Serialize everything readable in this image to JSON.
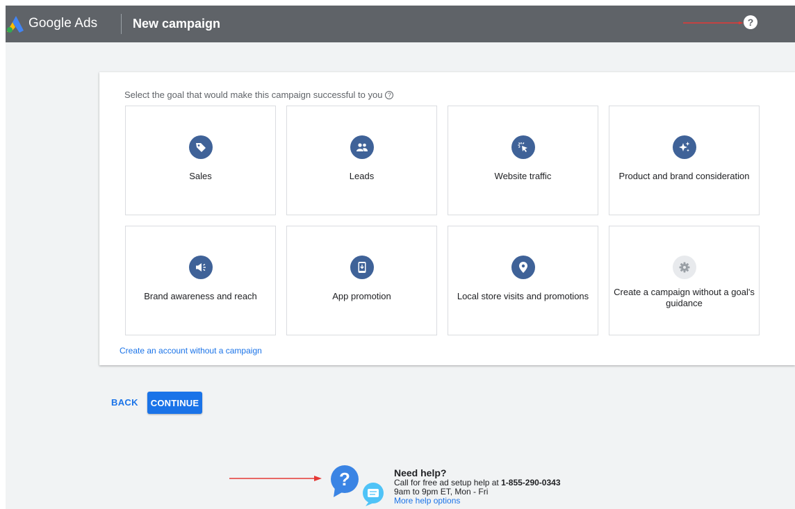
{
  "header": {
    "brand": "Google Ads",
    "page_title": "New campaign",
    "help_icon": "question-circle-icon"
  },
  "goal_section": {
    "prompt": "Select the goal that would make this campaign successful to you",
    "goals": [
      {
        "label": "Sales",
        "icon": "tag-icon"
      },
      {
        "label": "Leads",
        "icon": "people-icon"
      },
      {
        "label": "Website traffic",
        "icon": "cursor-click-icon"
      },
      {
        "label": "Product and brand consideration",
        "icon": "sparkle-icon"
      },
      {
        "label": "Brand awareness and reach",
        "icon": "megaphone-icon"
      },
      {
        "label": "App promotion",
        "icon": "phone-download-icon"
      },
      {
        "label": "Local store visits and promotions",
        "icon": "map-pin-icon"
      },
      {
        "label": "Create a campaign without a goal's guidance",
        "icon": "gear-icon"
      }
    ],
    "no_campaign_link": "Create an account without a campaign"
  },
  "actions": {
    "back_label": "BACK",
    "continue_label": "CONTINUE"
  },
  "help": {
    "title": "Need help?",
    "call_prefix": "Call for free ad setup help at ",
    "phone": "1-855-290-0343",
    "hours": "9am to 9pm ET, Mon - Fri",
    "more_link": "More help options"
  },
  "colors": {
    "header_bg": "#5f6368",
    "accent": "#1a73e8",
    "icon_bg": "#3f6298",
    "annotation_arrow": "#e53935"
  }
}
